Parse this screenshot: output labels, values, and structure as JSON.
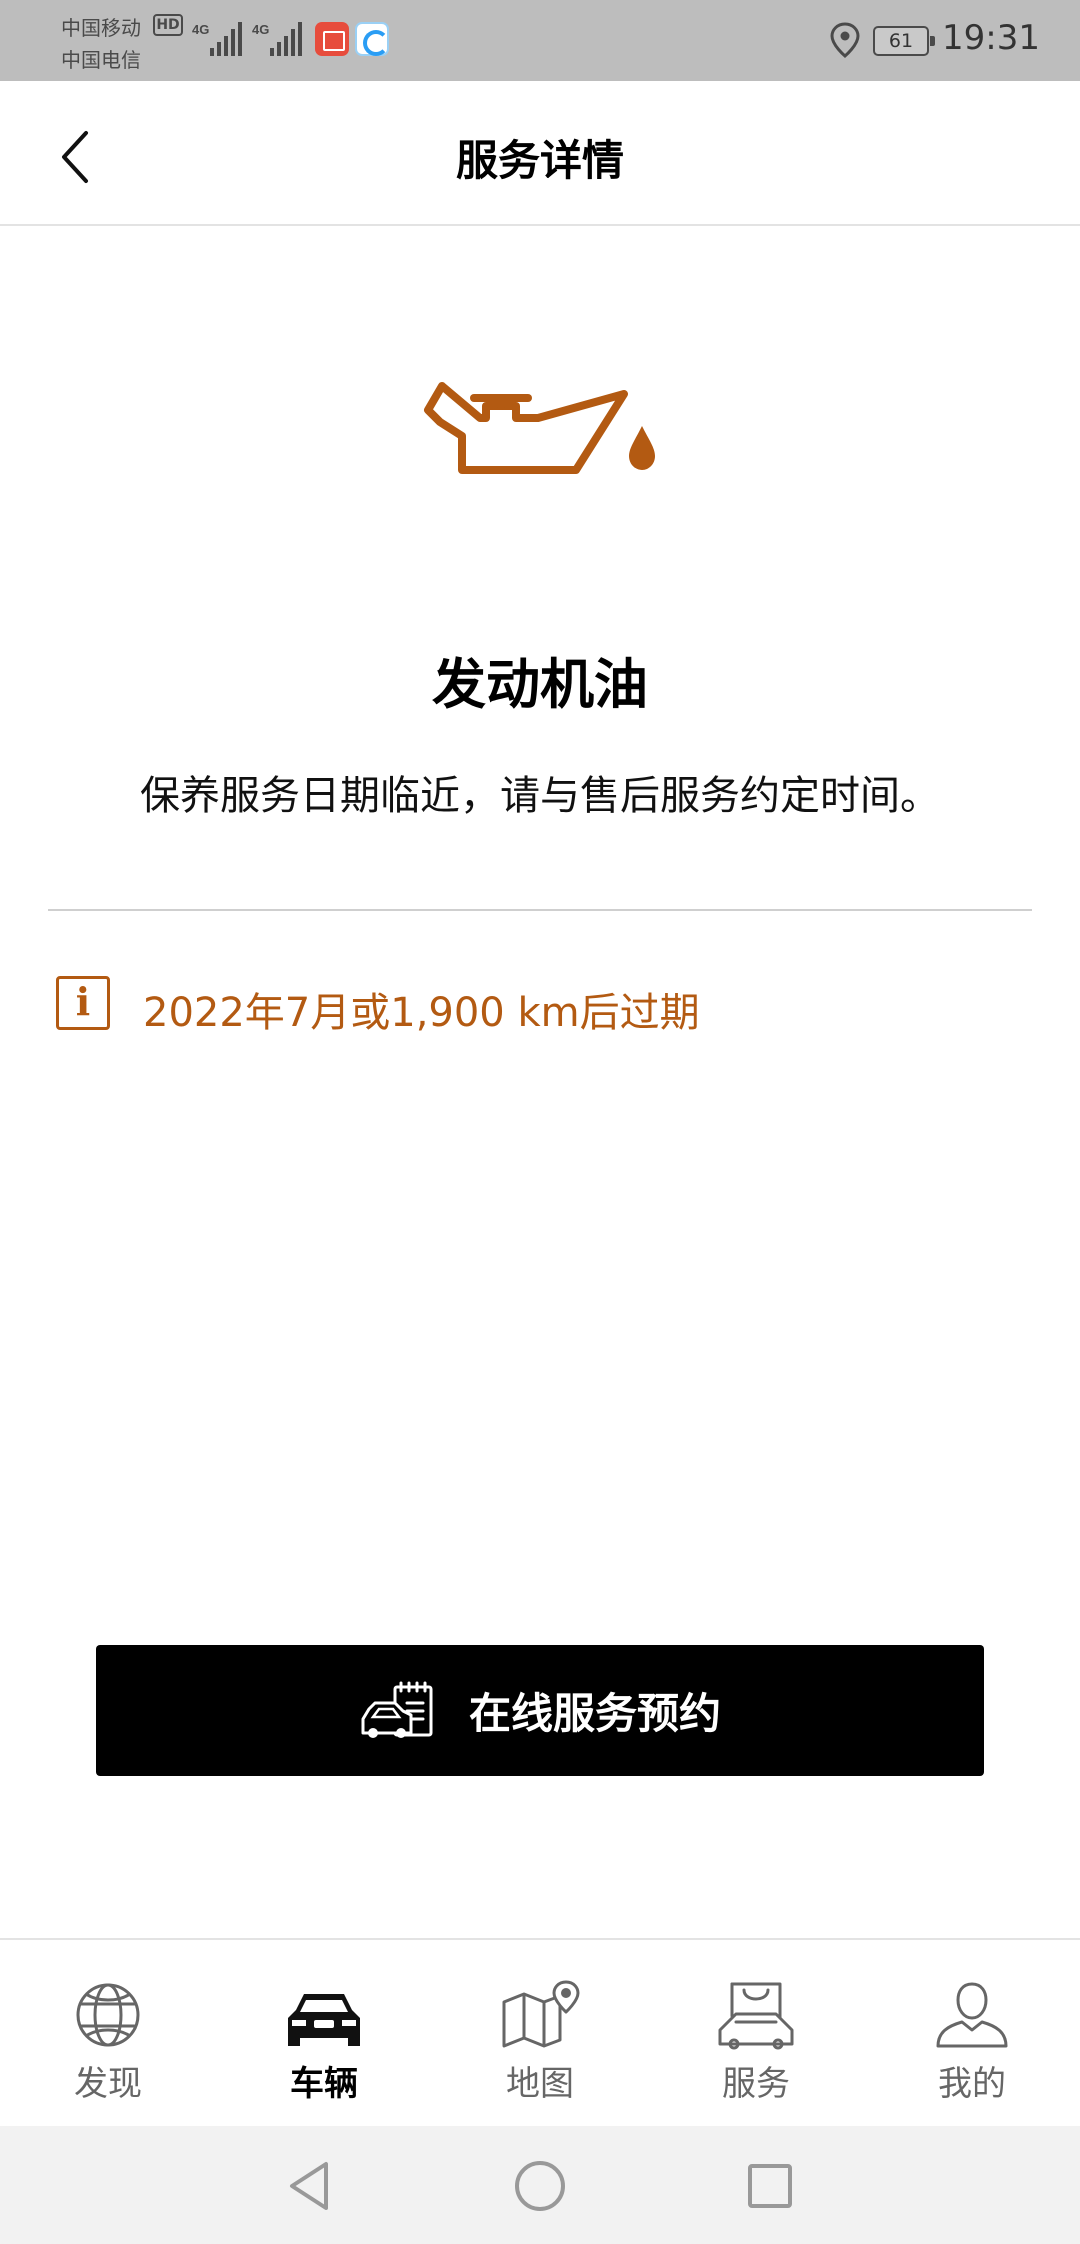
{
  "status_bar": {
    "carrier1": "中国移动",
    "carrier2": "中国电信",
    "hd": "HD",
    "network1": "4G",
    "network2": "4G",
    "battery": "61",
    "time": "19:31"
  },
  "header": {
    "title": "服务详情"
  },
  "service": {
    "icon": "oil-can-icon",
    "title": "发动机油",
    "description": "保养服务日期临近，请与售后服务约定时间。",
    "due_text": "2022年7月或1,900 km后过期",
    "accent_color": "#b35a12"
  },
  "booking_button": {
    "label": "在线服务预约"
  },
  "bottom_nav": {
    "items": [
      {
        "label": "发现",
        "icon": "globe-icon"
      },
      {
        "label": "车辆",
        "icon": "car-icon",
        "active": true
      },
      {
        "label": "地图",
        "icon": "map-icon"
      },
      {
        "label": "服务",
        "icon": "service-icon"
      },
      {
        "label": "我的",
        "icon": "profile-icon"
      }
    ]
  }
}
